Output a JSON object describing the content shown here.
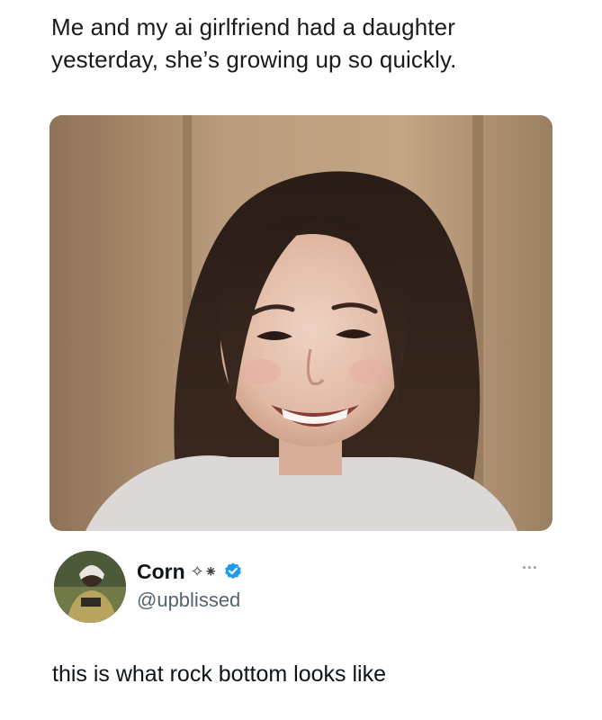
{
  "caption": {
    "line1": "Me and my ai girlfriend had a daughter",
    "line2": "yesterday, she’s growing up so quickly."
  },
  "photo": {
    "icon": "portrait-photo"
  },
  "author": {
    "display_name": "Corn",
    "name_glyphs": "✧⁕",
    "handle": "@upblissed",
    "verified_color": "#1d9bf0",
    "avatar_icon": "avatar-photo"
  },
  "post": {
    "text": "this is what rock bottom looks like"
  },
  "colors": {
    "handle": "#536471",
    "text": "#0f1419"
  }
}
